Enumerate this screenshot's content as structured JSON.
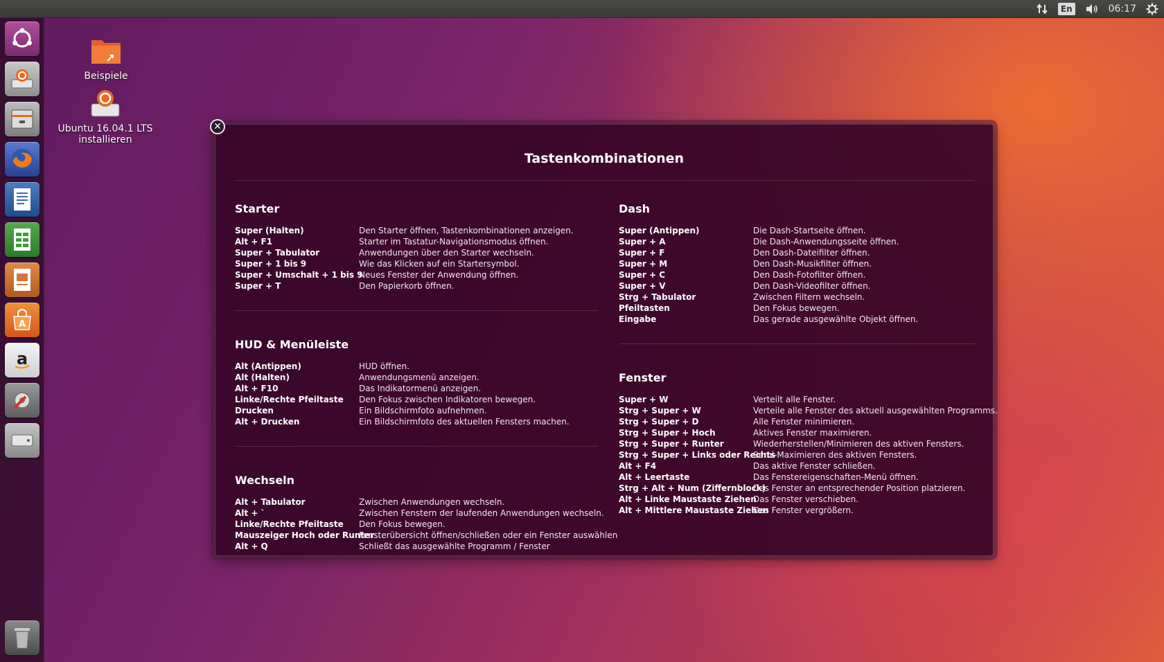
{
  "panel": {
    "lang": "En",
    "time": "06:17"
  },
  "desktop": {
    "icons": [
      {
        "label": "Beispiele"
      },
      {
        "label": "Ubuntu 16.04.1 LTS installieren"
      }
    ]
  },
  "launcher": {
    "icons": [
      "ubuntu-dash-icon",
      "install-ubuntu-icon",
      "files-icon",
      "firefox-icon",
      "writer-icon",
      "calc-icon",
      "impress-icon",
      "software-center-icon",
      "amazon-icon",
      "system-settings-icon",
      "drive-icon",
      "trash-icon"
    ]
  },
  "overlay": {
    "title": "Tastenkombinationen",
    "left_sections": [
      {
        "heading": "Starter",
        "rows": [
          {
            "key": "Super (Halten)",
            "desc": "Den Starter öffnen, Tastenkombinationen anzeigen."
          },
          {
            "key": "Alt + F1",
            "desc": "Starter im Tastatur-Navigationsmodus öffnen."
          },
          {
            "key": "Super + Tabulator",
            "desc": "Anwendungen über den Starter wechseln."
          },
          {
            "key": "Super + 1 bis 9",
            "desc": "Wie das Klicken auf ein Startersymbol."
          },
          {
            "key": "Super + Umschalt + 1 bis 9",
            "desc": "Neues Fenster der Anwendung öffnen."
          },
          {
            "key": "Super + T",
            "desc": "Den Papierkorb öffnen."
          }
        ]
      },
      {
        "heading": "HUD & Menüleiste",
        "rows": [
          {
            "key": "Alt (Antippen)",
            "desc": "HUD öffnen."
          },
          {
            "key": "Alt (Halten)",
            "desc": "Anwendungsmenü anzeigen."
          },
          {
            "key": "Alt + F10",
            "desc": "Das Indikatormenü anzeigen."
          },
          {
            "key": "Linke/Rechte Pfeiltaste",
            "desc": "Den Fokus zwischen Indikatoren bewegen."
          },
          {
            "key": "Drucken",
            "desc": "Ein Bildschirmfoto aufnehmen."
          },
          {
            "key": "Alt + Drucken",
            "desc": "Ein Bildschirmfoto des aktuellen Fensters machen."
          }
        ]
      },
      {
        "heading": "Wechseln",
        "rows": [
          {
            "key": "Alt + Tabulator",
            "desc": "Zwischen Anwendungen wechseln."
          },
          {
            "key": "Alt + `",
            "desc": "Zwischen Fenstern der laufenden Anwendungen wechseln."
          },
          {
            "key": "Linke/Rechte Pfeiltaste",
            "desc": "Den Fokus bewegen."
          },
          {
            "key": "Mauszeiger Hoch oder Runter",
            "desc": "Fensterübersicht öffnen/schließen oder ein Fenster auswählen"
          },
          {
            "key": "Alt + Q",
            "desc": "Schließt das ausgewählte Programm / Fenster"
          }
        ]
      }
    ],
    "right_sections": [
      {
        "heading": "Dash",
        "rows": [
          {
            "key": "Super (Antippen)",
            "desc": "Die Dash-Startseite öffnen."
          },
          {
            "key": "Super + A",
            "desc": "Die Dash-Anwendungsseite öffnen."
          },
          {
            "key": "Super + F",
            "desc": "Den Dash-Dateifilter öffnen."
          },
          {
            "key": "Super + M",
            "desc": "Den Dash-Musikfilter öffnen."
          },
          {
            "key": "Super + C",
            "desc": "Den Dash-Fotofilter öffnen."
          },
          {
            "key": "Super + V",
            "desc": "Den Dash-Videofilter öffnen."
          },
          {
            "key": "Strg + Tabulator",
            "desc": "Zwischen Filtern wechseln."
          },
          {
            "key": "Pfeiltasten",
            "desc": "Den Fokus bewegen."
          },
          {
            "key": "Eingabe",
            "desc": "Das gerade ausgewählte Objekt öffnen."
          }
        ]
      },
      {
        "heading": "Fenster",
        "rows": [
          {
            "key": "Super + W",
            "desc": "Verteilt alle Fenster."
          },
          {
            "key": "Strg + Super + W",
            "desc": "Verteile alle Fenster des aktuell ausgewählten Programms."
          },
          {
            "key": "Strg + Super + D",
            "desc": "Alle Fenster minimieren."
          },
          {
            "key": "Strg + Super + Hoch",
            "desc": "Aktives Fenster maximieren."
          },
          {
            "key": "Strg + Super + Runter",
            "desc": "Wiederherstellen/Minimieren des aktiven Fensters."
          },
          {
            "key": "Strg + Super + Links oder Rechts",
            "desc": "Semi-Maximieren des aktiven Fensters."
          },
          {
            "key": "Alt + F4",
            "desc": "Das aktive Fenster schließen."
          },
          {
            "key": "Alt + Leertaste",
            "desc": "Das Fenstereigenschaften-Menü öffnen."
          },
          {
            "key": "Strg + Alt + Num (Ziffernblock)",
            "desc": "Das Fenster an entsprechender Position platzieren."
          },
          {
            "key": "Alt + Linke Maustaste Ziehen",
            "desc": "Das Fenster verschieben."
          },
          {
            "key": "Alt + Mittlere Maustaste Ziehen",
            "desc": "Das Fenster vergrößern."
          }
        ]
      }
    ]
  }
}
